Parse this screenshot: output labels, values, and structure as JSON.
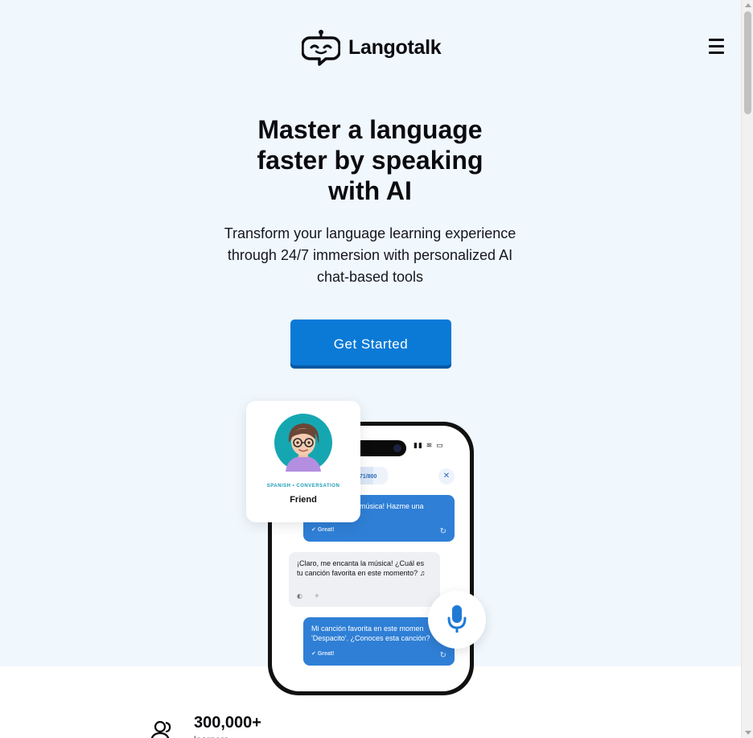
{
  "header": {
    "brand": "Langotalk",
    "logo_icon": "speech-bubble-robot-logo",
    "menu_icon": "hamburger-menu-icon"
  },
  "hero": {
    "headline_line1": "Master a language",
    "headline_line2": "faster by speaking",
    "headline_line3": "with AI",
    "subhead_line1": "Transform your language learning experience",
    "subhead_line2": "through 24/7 immersion with personalized AI",
    "subhead_line3": "chat-based tools",
    "cta_label": "Get Started"
  },
  "phone": {
    "counter": "71/800",
    "messages": [
      {
        "role": "user",
        "text": "¡Me encanta la música! Hazme una",
        "visible_text": "música! Hazme una",
        "status": "Great!"
      },
      {
        "role": "ai",
        "text": "¡Claro, me encanta la música! ¿Cuál es tu canción favorita en este momento? ♫"
      },
      {
        "role": "user",
        "text": "Mi canción favorita en este momen 'Despacito'. ¿Conoces esta canción?",
        "status": "Great!"
      }
    ]
  },
  "tutor_card": {
    "tag": "SPANISH  •  CONVERSATION",
    "name": "Friend"
  },
  "stats": {
    "value": "300,000+",
    "label": "learners",
    "icon": "users-icon"
  },
  "colors": {
    "hero_bg": "#f0f7fd",
    "primary": "#0a7ad6",
    "bubble_user": "#2f7fd6",
    "tag": "#1d9bb7"
  }
}
